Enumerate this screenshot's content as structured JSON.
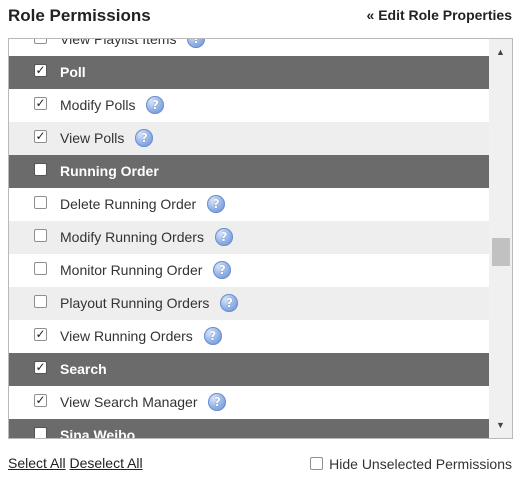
{
  "header": {
    "title": "Role Permissions",
    "edit_link": "« Edit Role Properties"
  },
  "help_glyph": "?",
  "permissions": [
    {
      "kind": "perm",
      "label": "View Playlist Items",
      "checked": false,
      "help": true
    },
    {
      "kind": "group",
      "label": "Poll",
      "checked": true,
      "help": false
    },
    {
      "kind": "perm",
      "label": "Modify Polls",
      "checked": true,
      "help": true
    },
    {
      "kind": "perm",
      "label": "View Polls",
      "checked": true,
      "help": true
    },
    {
      "kind": "group",
      "label": "Running Order",
      "checked": false,
      "help": false
    },
    {
      "kind": "perm",
      "label": "Delete Running Order",
      "checked": false,
      "help": true
    },
    {
      "kind": "perm",
      "label": "Modify Running Orders",
      "checked": false,
      "help": true
    },
    {
      "kind": "perm",
      "label": "Monitor Running Order",
      "checked": false,
      "help": true
    },
    {
      "kind": "perm",
      "label": "Playout Running Orders",
      "checked": false,
      "help": true
    },
    {
      "kind": "perm",
      "label": "View Running Orders",
      "checked": true,
      "help": true
    },
    {
      "kind": "group",
      "label": "Search",
      "checked": true,
      "help": false
    },
    {
      "kind": "perm",
      "label": "View Search Manager",
      "checked": true,
      "help": true
    },
    {
      "kind": "group",
      "label": "Sina Weibo",
      "checked": false,
      "help": false
    }
  ],
  "scrollbar": {
    "up_arrow": "▲",
    "down_arrow": "▼"
  },
  "footer": {
    "select_all": "Select All",
    "deselect_all": "Deselect All",
    "hide_unselected_label": "Hide Unselected Permissions",
    "hide_unselected_checked": false
  }
}
